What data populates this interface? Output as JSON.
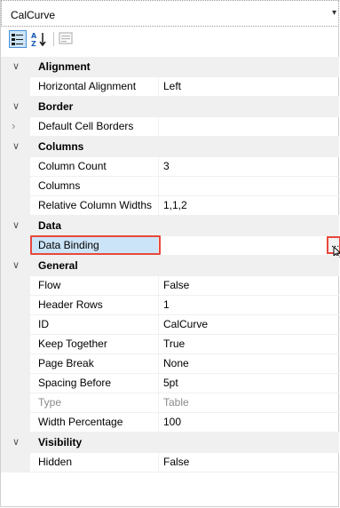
{
  "object_selector": {
    "value": "CalCurve"
  },
  "toolbar": {
    "categorized_icon": "categorized-icon",
    "alphabetical_icon": "alphabetical-icon",
    "property_pages_icon": "property-pages-icon"
  },
  "grid": {
    "alignment": {
      "label": "Alignment",
      "horizontal_alignment": {
        "name": "Horizontal Alignment",
        "value": "Left"
      }
    },
    "border": {
      "label": "Border",
      "default_cell_borders": {
        "name": "Default Cell Borders",
        "value": ""
      }
    },
    "columns": {
      "label": "Columns",
      "column_count": {
        "name": "Column Count",
        "value": "3"
      },
      "columns": {
        "name": "Columns",
        "value": ""
      },
      "relative_column_widths": {
        "name": "Relative Column Widths",
        "value": "1,1,2"
      }
    },
    "data": {
      "label": "Data",
      "data_binding": {
        "name": "Data Binding",
        "value": "",
        "button": "..."
      }
    },
    "general": {
      "label": "General",
      "flow": {
        "name": "Flow",
        "value": "False"
      },
      "header_rows": {
        "name": "Header Rows",
        "value": "1"
      },
      "id": {
        "name": "ID",
        "value": "CalCurve"
      },
      "keep_together": {
        "name": "Keep Together",
        "value": "True"
      },
      "page_break": {
        "name": "Page Break",
        "value": "None"
      },
      "spacing_before": {
        "name": "Spacing Before",
        "value": "5pt"
      },
      "type": {
        "name": "Type",
        "value": "Table"
      },
      "width_percentage": {
        "name": "Width Percentage",
        "value": "100"
      }
    },
    "visibility": {
      "label": "Visibility",
      "hidden": {
        "name": "Hidden",
        "value": "False"
      }
    }
  },
  "colors": {
    "highlight_border": "#e8483b",
    "selection_fill": "#cce4f7",
    "gutter": "#f0f0f0"
  }
}
